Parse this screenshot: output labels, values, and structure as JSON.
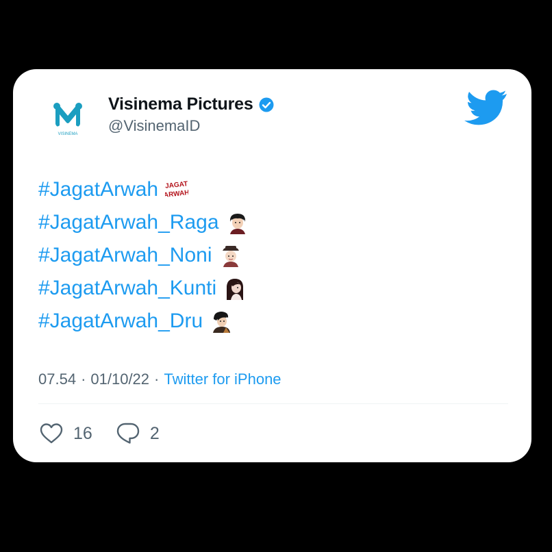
{
  "colors": {
    "accent": "#1d9bf0",
    "text": "#0f1419",
    "secondary": "#536471",
    "background": "#000000"
  },
  "author": {
    "display_name": "Visinema Pictures",
    "handle": "@VisinemaID",
    "verified_icon": "verified-badge-icon",
    "avatar_logo_text": "VISINEMA"
  },
  "tweet": {
    "lines": [
      {
        "text": "#JagatArwah",
        "emoji": "jagat-arwah-logo-emoji",
        "emoji_text": [
          "JAGAT",
          "ARWAH"
        ]
      },
      {
        "text": "#JagatArwah_Raga",
        "emoji": "raga-character-emoji"
      },
      {
        "text": "#JagatArwah_Noni",
        "emoji": "noni-character-emoji"
      },
      {
        "text": "#JagatArwah_Kunti",
        "emoji": "kunti-character-emoji"
      },
      {
        "text": "#JagatArwah_Dru",
        "emoji": "dru-character-emoji"
      }
    ],
    "time": "07.54",
    "date": "01/10/22",
    "separator": "·",
    "source": "Twitter for iPhone"
  },
  "actions": {
    "likes": "16",
    "replies": "2"
  }
}
